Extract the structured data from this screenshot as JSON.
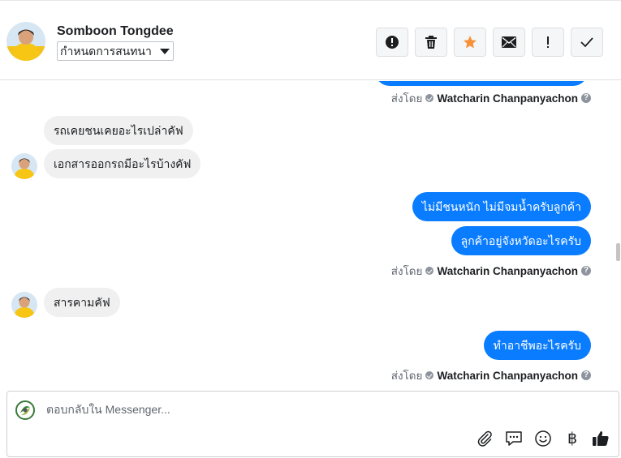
{
  "header": {
    "contact_name": "Somboon Tongdee",
    "conversation_dropdown": "กำหนดการสนทนา",
    "toolbar": [
      {
        "name": "report-spam-button",
        "icon": "alert-circle-icon"
      },
      {
        "name": "delete-button",
        "icon": "trash-icon"
      },
      {
        "name": "star-button",
        "icon": "star-icon"
      },
      {
        "name": "mark-unread-button",
        "icon": "envelope-icon"
      },
      {
        "name": "follow-up-button",
        "icon": "exclamation-icon"
      },
      {
        "name": "mark-done-button",
        "icon": "check-icon"
      }
    ]
  },
  "chat": {
    "sent_by_prefix": "ส่งโดย",
    "sender": "Watcharin Chanpanyachon",
    "messages": [
      {
        "dir": "in",
        "text": "รถเคยชนเคยอะไรเปล่าคัฟ"
      },
      {
        "dir": "in",
        "text": "เอกสารออกรถมีอะไรบ้างคัฟ"
      },
      {
        "dir": "out",
        "text": "ไม่มีชนหนัก ไม่มีจมน้ำครับลูกค้า"
      },
      {
        "dir": "out",
        "text": "ลูกค้าอยู่จังหวัดอะไรครับ"
      },
      {
        "dir": "in",
        "text": "สารคามคัฟ"
      },
      {
        "dir": "out",
        "text": "ทำอาชีพอะไรครับ"
      }
    ]
  },
  "composer": {
    "placeholder": "ตอบกลับใน Messenger...",
    "baht_symbol": "฿"
  },
  "colors": {
    "outgoing_bubble": "#0a7cff",
    "incoming_bubble": "#f0f0f0",
    "star": "#f7923b",
    "like": "#1c1e21"
  }
}
